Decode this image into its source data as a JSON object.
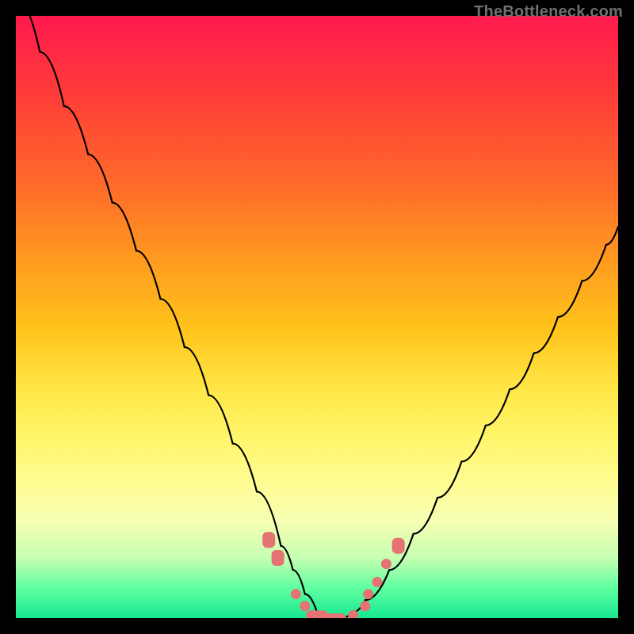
{
  "watermark": "TheBottleneck.com",
  "colors": {
    "curve_stroke": "#000000",
    "marker_fill": "#e57373",
    "bg_black": "#000000"
  },
  "chart_data": {
    "type": "line",
    "title": "",
    "xlabel": "",
    "ylabel": "",
    "xlim": [
      0,
      100
    ],
    "ylim": [
      0,
      100
    ],
    "x": [
      0,
      4,
      8,
      12,
      16,
      20,
      24,
      28,
      32,
      36,
      40,
      44,
      46,
      48,
      50,
      52,
      54,
      56,
      58,
      62,
      66,
      70,
      74,
      78,
      82,
      86,
      90,
      94,
      98,
      100
    ],
    "values": [
      103,
      94,
      85,
      77,
      69,
      61,
      53,
      45,
      37,
      29,
      21,
      12,
      8,
      4,
      1,
      0,
      0,
      1,
      3,
      8,
      14,
      20,
      26,
      32,
      38,
      44,
      50,
      56,
      62,
      65
    ],
    "markers": [
      {
        "x": 42,
        "y": 13,
        "shape": "rounded-rect"
      },
      {
        "x": 43.5,
        "y": 10,
        "shape": "rounded-rect"
      },
      {
        "x": 46.5,
        "y": 4,
        "shape": "small"
      },
      {
        "x": 48,
        "y": 2,
        "shape": "small"
      },
      {
        "x": 50,
        "y": 0.5,
        "shape": "pill"
      },
      {
        "x": 53,
        "y": 0,
        "shape": "pill"
      },
      {
        "x": 56,
        "y": 0.5,
        "shape": "small"
      },
      {
        "x": 58,
        "y": 2,
        "shape": "small"
      },
      {
        "x": 58.5,
        "y": 4,
        "shape": "small"
      },
      {
        "x": 60,
        "y": 6,
        "shape": "small"
      },
      {
        "x": 61.5,
        "y": 9,
        "shape": "small"
      },
      {
        "x": 63.5,
        "y": 12,
        "shape": "rounded-rect"
      }
    ],
    "annotations": []
  }
}
